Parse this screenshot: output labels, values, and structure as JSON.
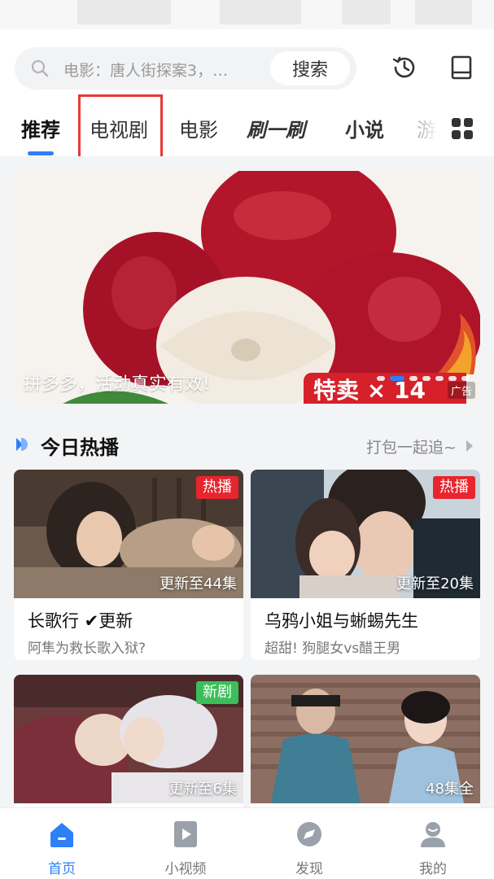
{
  "search": {
    "placeholder": "电影：唐人街探案3，…",
    "button_label": "搜索"
  },
  "header_icons": [
    "history-icon",
    "bookshelf-icon"
  ],
  "tabs": [
    {
      "label": "推荐",
      "active": true
    },
    {
      "label": "电视剧"
    },
    {
      "label": "电影"
    },
    {
      "label": "刷一刷"
    },
    {
      "label": "小说"
    },
    {
      "label": "游"
    }
  ],
  "banner": {
    "caption": "拼多多，活动真实有效!",
    "badge_text": "特卖 × 14",
    "ad_label": "广告",
    "slide_count": 7,
    "active_slide": 1
  },
  "section": {
    "title": "今日热播",
    "more_label": "打包一起追~"
  },
  "cards": [
    {
      "title": "长歌行 ✔更新",
      "subtitle": "阿隼为救长歌入狱?",
      "badge": "热播",
      "badge_color": "#e8252d",
      "episodes": "更新至44集"
    },
    {
      "title": "乌鸦小姐与蜥蜴先生",
      "subtitle": "超甜! 狗腿女vs醋王男",
      "badge": "热播",
      "badge_color": "#e8252d",
      "episodes": "更新至20集"
    },
    {
      "title": "",
      "subtitle": "",
      "badge": "新剧",
      "badge_color": "#3cbf5a",
      "episodes": "更新至6集"
    },
    {
      "title": "",
      "subtitle": "",
      "badge": "",
      "badge_color": "",
      "episodes": "48集全"
    }
  ],
  "bottom_nav": [
    {
      "label": "首页",
      "icon": "home-icon",
      "active": true
    },
    {
      "label": "小视频",
      "icon": "short-video-icon"
    },
    {
      "label": "发现",
      "icon": "compass-icon"
    },
    {
      "label": "我的",
      "icon": "profile-icon"
    }
  ],
  "colors": {
    "accent": "#2f7ff7",
    "highlight_box": "#e53935"
  }
}
